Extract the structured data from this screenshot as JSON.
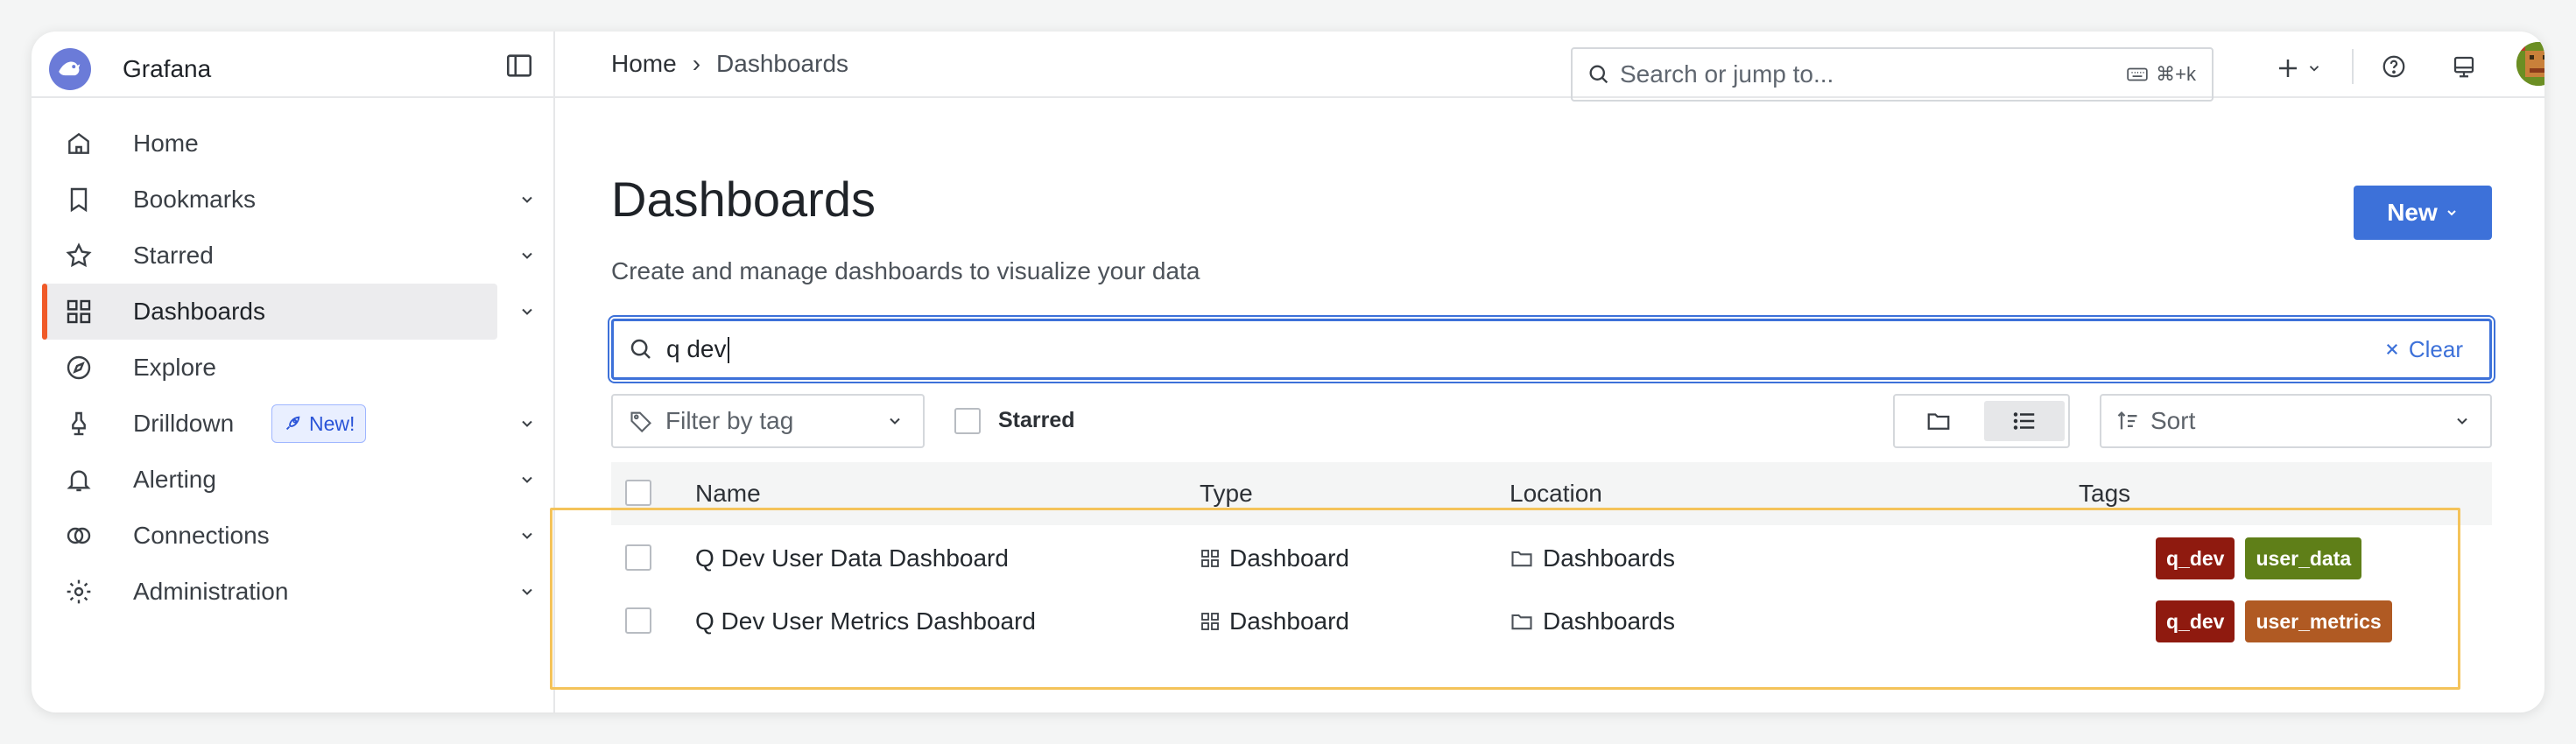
{
  "app": {
    "name": "Grafana"
  },
  "sidebar": {
    "items": [
      {
        "label": "Home",
        "icon": "home-icon",
        "chevron": false,
        "active": false
      },
      {
        "label": "Bookmarks",
        "icon": "bookmark-icon",
        "chevron": true,
        "active": false
      },
      {
        "label": "Starred",
        "icon": "star-icon",
        "chevron": true,
        "active": false
      },
      {
        "label": "Dashboards",
        "icon": "apps-icon",
        "chevron": true,
        "active": true
      },
      {
        "label": "Explore",
        "icon": "compass-icon",
        "chevron": false,
        "active": false
      },
      {
        "label": "Drilldown",
        "icon": "drilldown-icon",
        "chevron": true,
        "active": false,
        "badge": "New!"
      },
      {
        "label": "Alerting",
        "icon": "bell-icon",
        "chevron": true,
        "active": false
      },
      {
        "label": "Connections",
        "icon": "connections-icon",
        "chevron": true,
        "active": false
      },
      {
        "label": "Administration",
        "icon": "cog-icon",
        "chevron": true,
        "active": false
      }
    ]
  },
  "topbar": {
    "breadcrumb": [
      "Home",
      "Dashboards"
    ],
    "breadcrumb_separator": "›",
    "search_placeholder": "Search or jump to...",
    "search_shortcut": "⌘+k"
  },
  "main": {
    "title": "Dashboards",
    "subtitle": "Create and manage dashboards to visualize your data",
    "new_button": "New",
    "search_value": "q dev",
    "clear_label": "Clear",
    "filter_tag_label": "Filter by tag",
    "starred_label": "Starred",
    "sort_label": "Sort",
    "columns": {
      "name": "Name",
      "type": "Type",
      "location": "Location",
      "tags": "Tags"
    },
    "rows": [
      {
        "name": "Q Dev User Data Dashboard",
        "type": "Dashboard",
        "location": "Dashboards",
        "tags": [
          {
            "label": "q_dev",
            "color": "#8f1a0f"
          },
          {
            "label": "user_data",
            "color": "#5f7f18"
          }
        ]
      },
      {
        "name": "Q Dev User Metrics Dashboard",
        "type": "Dashboard",
        "location": "Dashboards",
        "tags": [
          {
            "label": "q_dev",
            "color": "#8f1a0f"
          },
          {
            "label": "user_metrics",
            "color": "#b05a23"
          }
        ]
      }
    ]
  },
  "colors": {
    "accent": "#3d71d9",
    "active_indicator": "#f05a28",
    "highlight_box": "#f4c35a"
  }
}
